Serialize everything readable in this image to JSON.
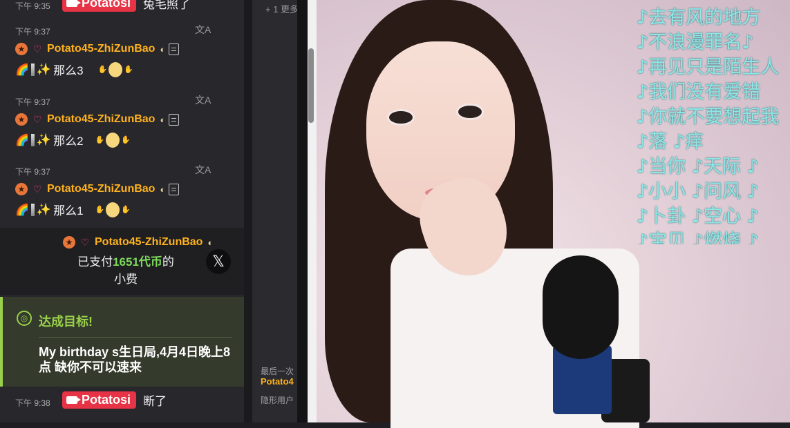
{
  "chat": {
    "top_partial": {
      "time": "下午 9:35",
      "tag": "Potatosi",
      "text": "兔毛照了"
    },
    "messages": [
      {
        "time": "下午 9:37",
        "username": "Potato45-ZhiZunBao",
        "text": "那么3"
      },
      {
        "time": "下午 9:37",
        "username": "Potato45-ZhiZunBao",
        "text": "那么2"
      },
      {
        "time": "下午 9:37",
        "username": "Potato45-ZhiZunBao",
        "text": "那么1"
      }
    ],
    "translate_icon": "文A",
    "tip": {
      "username": "Potato45-ZhiZunBao",
      "prefix": "已支付",
      "amount": "1651代币",
      "suffix": "的",
      "line2": "小费",
      "close": "𝕏"
    },
    "goal": {
      "title": "达成目标!",
      "description": "My birthday s生日局,4月4日晚上8点 缺你不可以速来"
    },
    "last_message": {
      "time": "下午 9:38",
      "tag": "Potatosi",
      "text": "断了"
    }
  },
  "side_panel": {
    "more": "+ 1 更多",
    "last_label": "最后一次",
    "user": "Potato4",
    "hidden": "隐形用户"
  },
  "video": {
    "lyrics": [
      "♪去有风的地方",
      "♪不浪漫罪名♪",
      "♪再见只是陌生人",
      "♪我们没有爱错",
      "♪你就不要想起我",
      "♪落 ♪痒",
      "♪当你 ♪天际 ♪",
      "♪小小 ♪问风 ♪",
      "♪卜卦 ♪空心 ♪",
      "♪宝贝 ♪燃烧 ♪"
    ]
  },
  "colors": {
    "username": "#ffb21e",
    "tag": "#e63346",
    "goal_accent": "#9ad14a",
    "tip_amount": "#7ddc5a",
    "lyric": "#8ee6e6"
  }
}
